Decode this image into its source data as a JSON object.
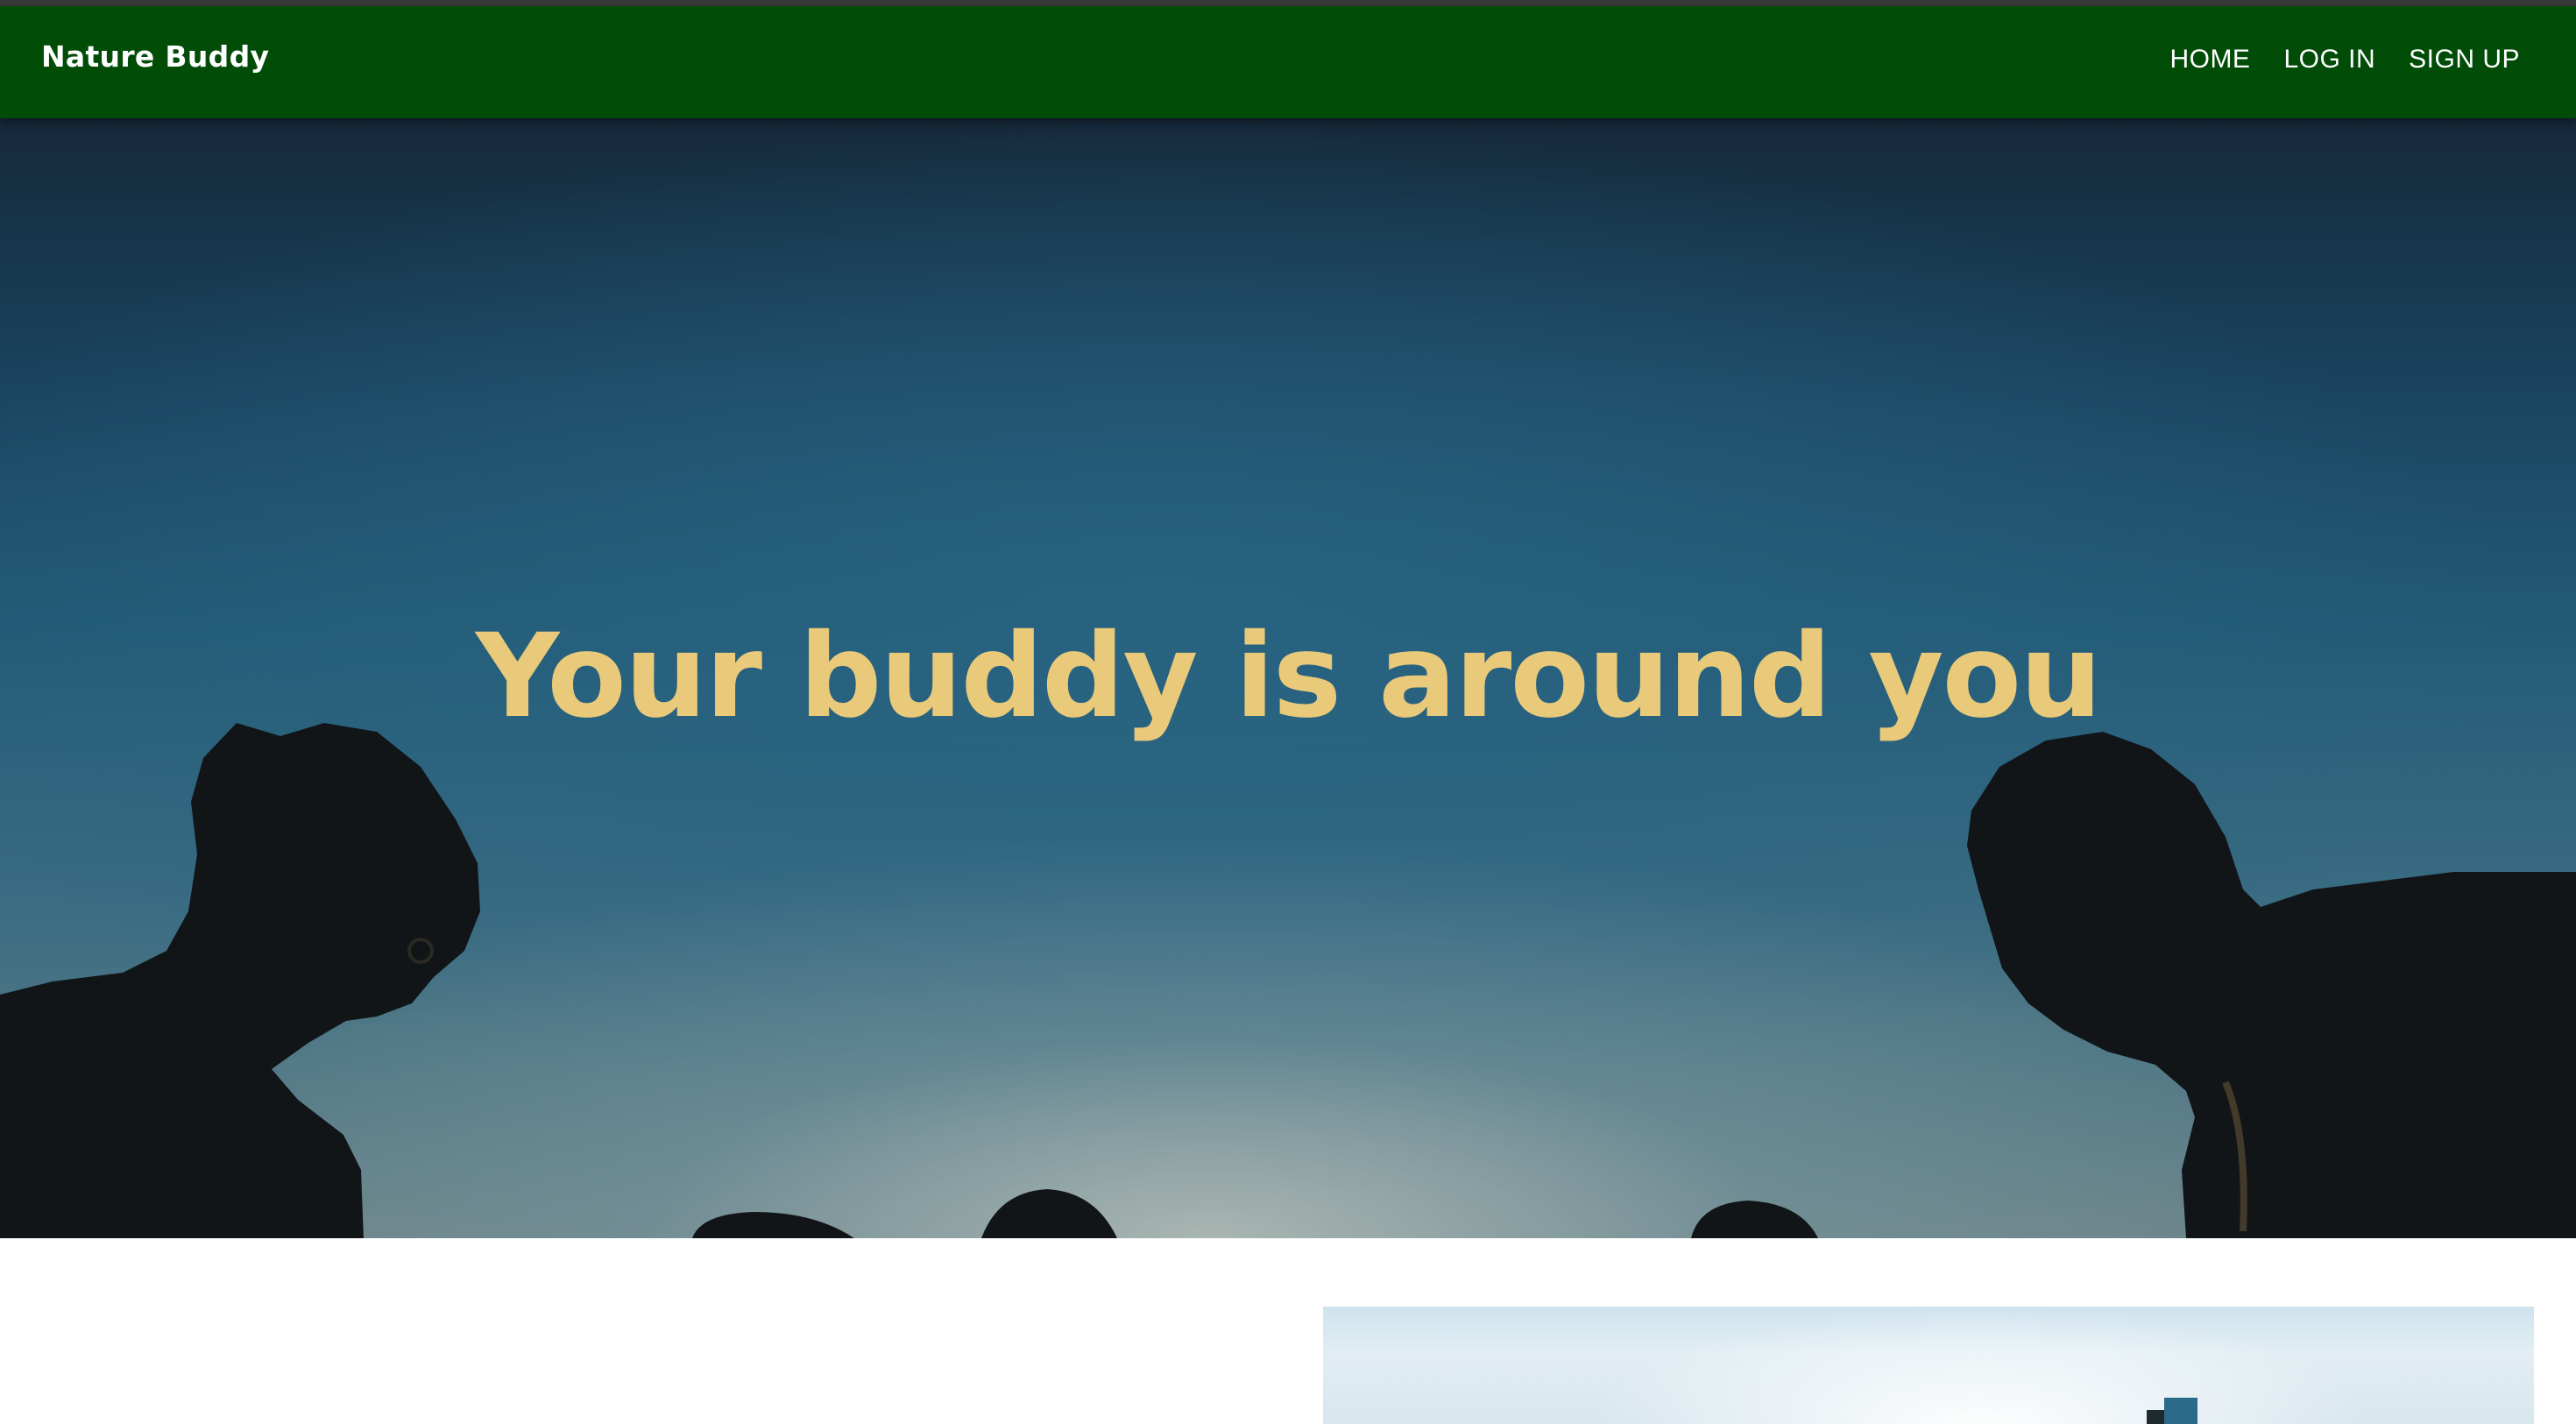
{
  "app": {
    "brand": "Nature Buddy"
  },
  "nav": {
    "items": [
      {
        "label": "HOME"
      },
      {
        "label": "LOG IN"
      },
      {
        "label": "SIGN UP"
      }
    ]
  },
  "hero": {
    "title": "Your buddy is around you"
  },
  "colors": {
    "navbar": "#014d08",
    "hero_title": "#e9c97a"
  }
}
